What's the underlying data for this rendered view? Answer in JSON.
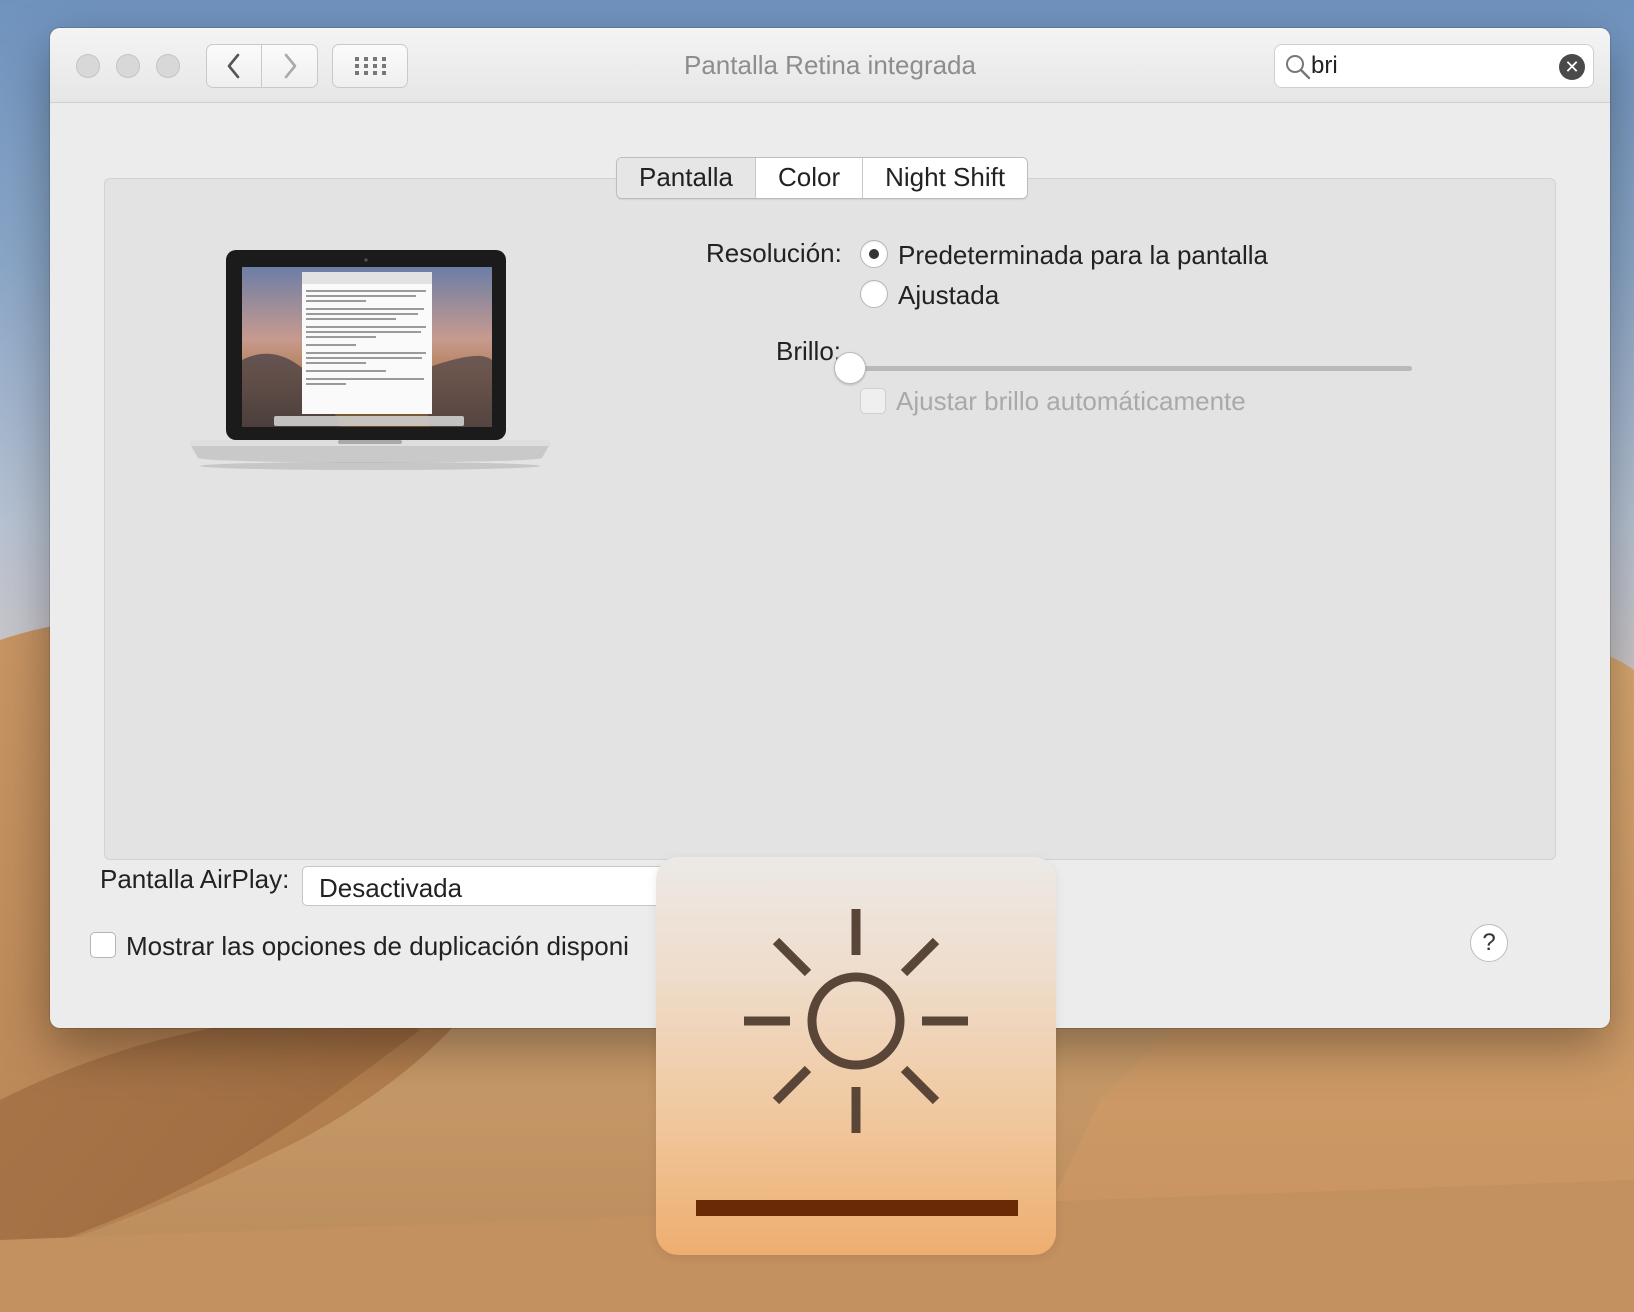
{
  "window": {
    "title": "Pantalla Retina integrada"
  },
  "search": {
    "value": "bri"
  },
  "tabs": [
    {
      "label": "Pantalla",
      "selected": true
    },
    {
      "label": "Color",
      "selected": false
    },
    {
      "label": "Night Shift",
      "selected": false
    }
  ],
  "resolution": {
    "label": "Resolución:",
    "options": [
      {
        "label": "Predeterminada para la pantalla",
        "selected": true
      },
      {
        "label": "Ajustada",
        "selected": false
      }
    ]
  },
  "brightness": {
    "label": "Brillo:",
    "level": 0.0,
    "auto_label": "Ajustar brillo automáticamente",
    "auto_enabled": false
  },
  "airplay": {
    "label": "Pantalla AirPlay:",
    "value": "Desactivada"
  },
  "mirroring": {
    "label": "Mostrar las opciones de duplicación disponi",
    "checked": false
  },
  "help": {
    "label": "?"
  },
  "hud": {
    "icon": "brightness-sun-icon",
    "level": 1.0
  },
  "colors": {
    "hud_bar": "#6b2a06",
    "hud_icon": "#5a4638"
  }
}
